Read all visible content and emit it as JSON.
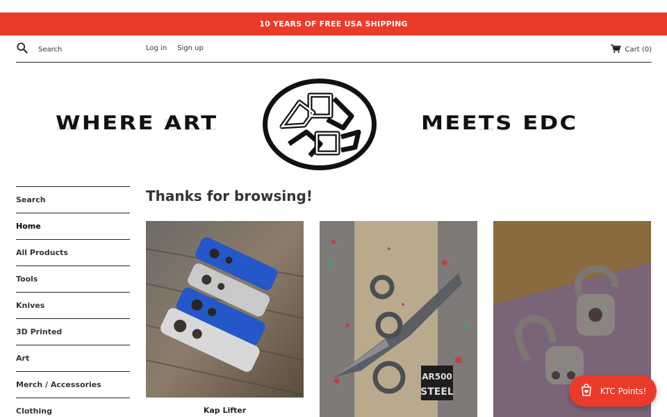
{
  "announcement": "10 YEARS OF FREE USA SHIPPING",
  "header": {
    "search_label": "Search",
    "login_label": "Log in",
    "signup_label": "Sign up",
    "cart_label": "Cart (0)"
  },
  "hero": {
    "left_text": "WHERE ART",
    "right_text": "MEETS EDC"
  },
  "sidebar": {
    "items": [
      {
        "label": "Search"
      },
      {
        "label": "Home"
      },
      {
        "label": "All Products"
      },
      {
        "label": "Tools"
      },
      {
        "label": "Knives"
      },
      {
        "label": "3D Printed"
      },
      {
        "label": "Art"
      },
      {
        "label": "Merch / Accessories"
      },
      {
        "label": "Clothing"
      }
    ]
  },
  "main": {
    "title": "Thanks for browsing!",
    "products": [
      {
        "name": "Kap Lifter"
      },
      {
        "name": ""
      },
      {
        "name": ""
      }
    ],
    "image_text": {
      "line1": "AR500",
      "line2": "STEEL"
    }
  },
  "points_button": "KTC Points!",
  "colors": {
    "accent": "#ec3a2a"
  }
}
